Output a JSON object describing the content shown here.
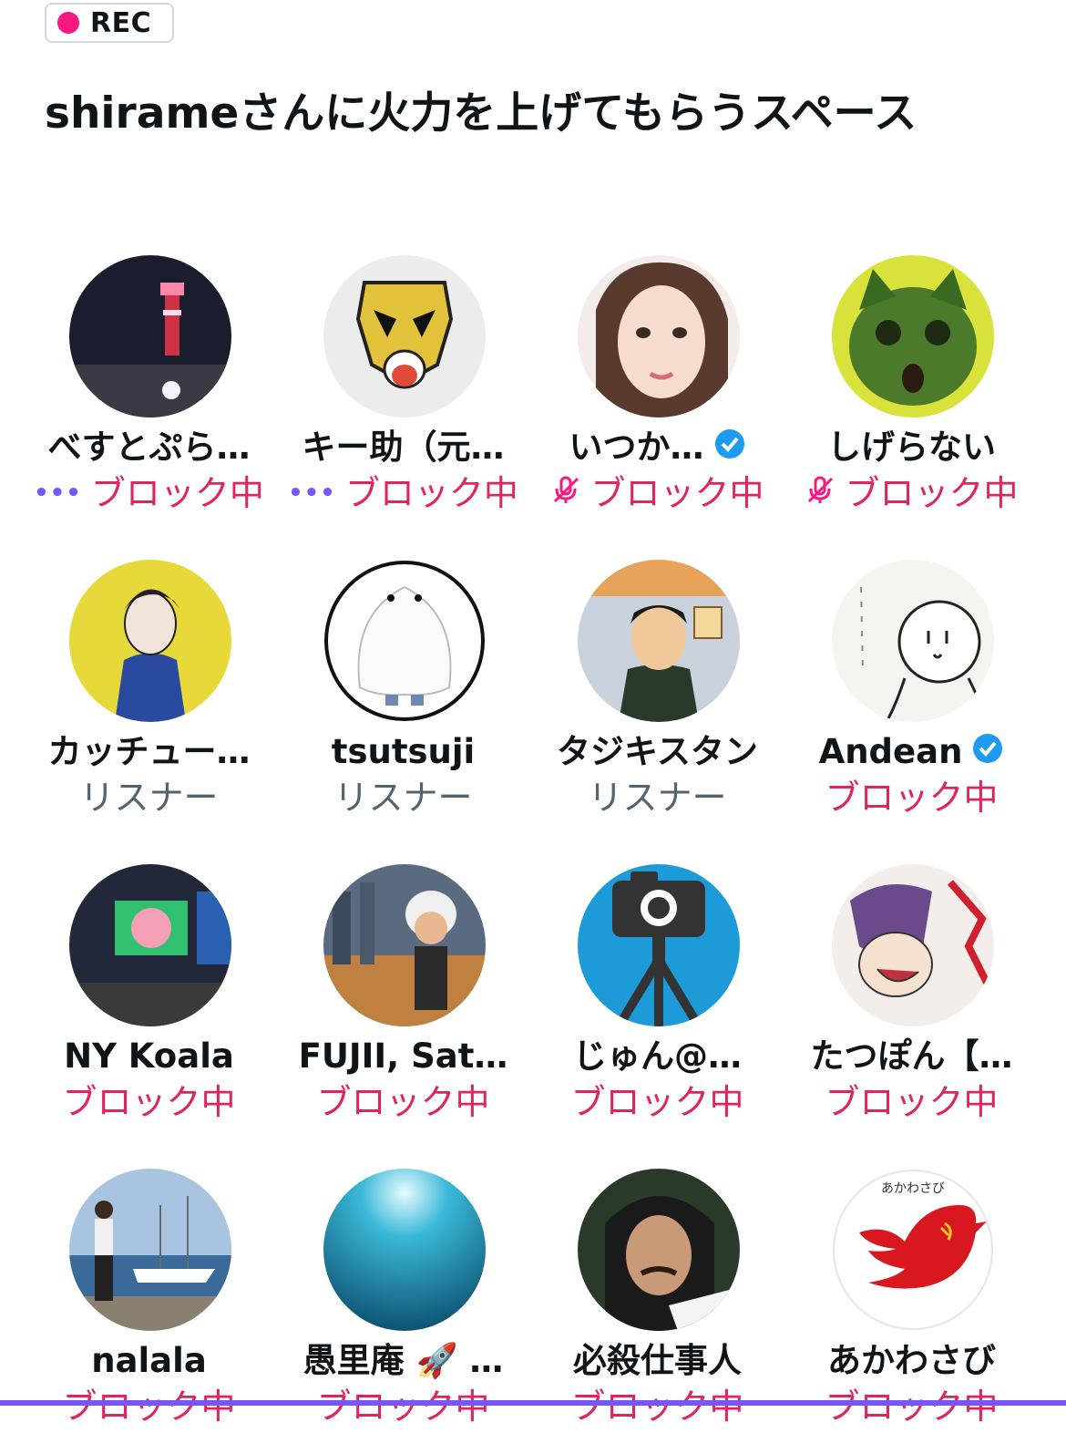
{
  "rec_badge": {
    "label": "REC",
    "dot_color": "#f91880"
  },
  "space": {
    "title": "shirameさんに火力を上げてもらうスペース"
  },
  "colors": {
    "blocked": "#e0245e",
    "listener": "#536471",
    "verified": "#1d9bf0",
    "speaking": "#7856ff"
  },
  "participants": [
    {
      "name": "べすとぷら…",
      "role": "ブロック中",
      "status_icon": "speaking-dots-icon",
      "status_text": "•••",
      "avatar": "tower-night"
    },
    {
      "name": "キー助（元…",
      "role": "ブロック中",
      "status_icon": "speaking-dots-icon",
      "status_text": "•••",
      "avatar": "tiger-mask"
    },
    {
      "name": "いつか…",
      "role": "ブロック中",
      "status_icon": "mic-off-icon",
      "verified": true,
      "avatar": "woman-portrait"
    },
    {
      "name": "しげらない",
      "role": "ブロック中",
      "status_icon": "mic-off-icon",
      "avatar": "green-cat"
    },
    {
      "name": "カッチュー…",
      "role": "リスナー",
      "avatar": "illustrated-man"
    },
    {
      "name": "tsutsuji",
      "role": "リスナー",
      "avatar": "ghost"
    },
    {
      "name": "タジキスタン",
      "role": "リスナー",
      "avatar": "shogi-man"
    },
    {
      "name": "Andean",
      "role": "ブロック中",
      "verified": true,
      "avatar": "shiranganai-doodle"
    },
    {
      "name": "NY Koala",
      "role": "ブロック中",
      "avatar": "times-square"
    },
    {
      "name": "FUJII, Sat…",
      "role": "ブロック中",
      "avatar": "einstein-city"
    },
    {
      "name": "じゅん@…",
      "role": "ブロック中",
      "avatar": "camera-tripod"
    },
    {
      "name": "たつぽん【…",
      "role": "ブロック中",
      "avatar": "manga-scream"
    },
    {
      "name": "nalala",
      "role": "ブロック中",
      "avatar": "harbor-woman"
    },
    {
      "name": "愚里庵 🚀 …",
      "role": "ブロック中",
      "avatar": "underwater"
    },
    {
      "name": "必殺仕事人",
      "role": "ブロック中",
      "avatar": "man-portrait"
    },
    {
      "name": "あかわさび",
      "role": "ブロック中",
      "avatar": "red-bird",
      "avatar_text": "あかわさび"
    }
  ]
}
